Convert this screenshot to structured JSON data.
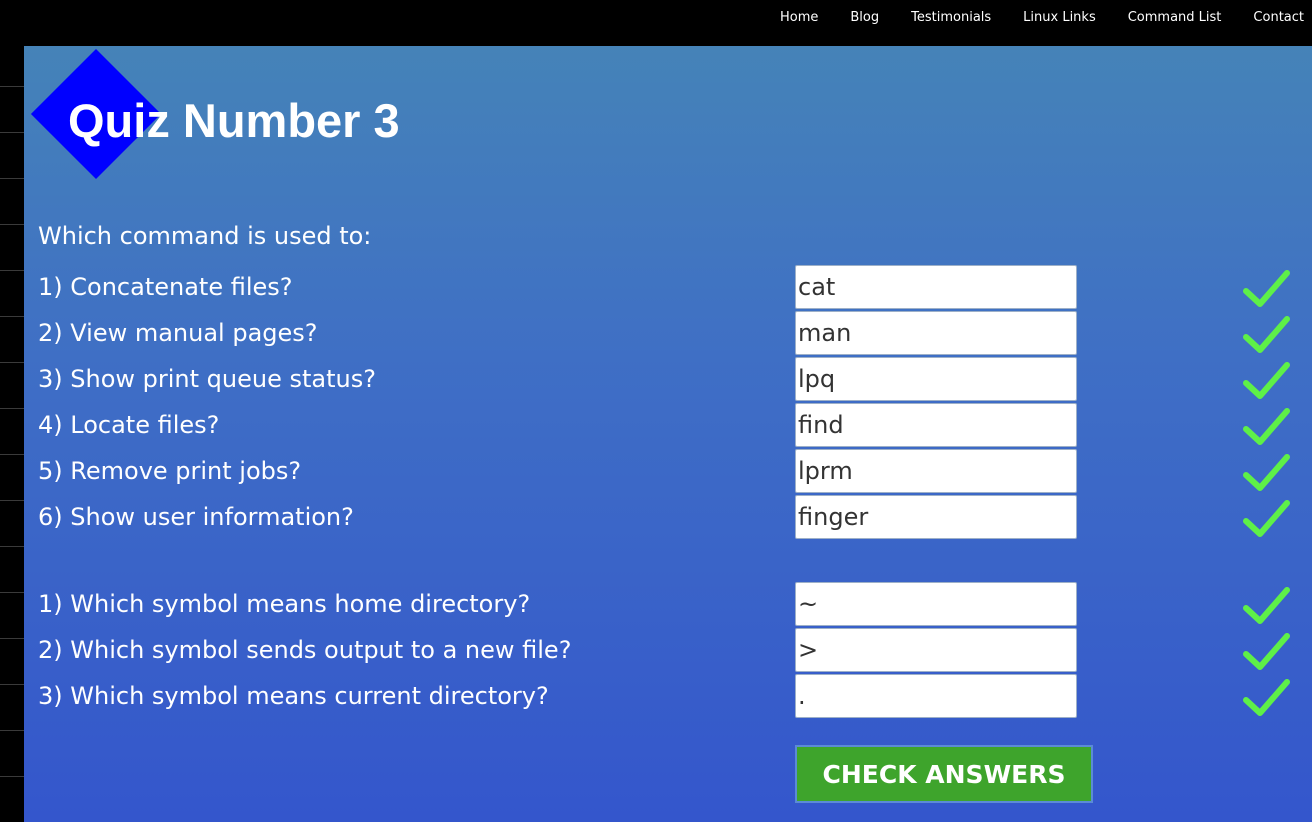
{
  "nav": {
    "items": [
      {
        "label": "Home"
      },
      {
        "label": "Blog"
      },
      {
        "label": "Testimonials"
      },
      {
        "label": "Linux Links"
      },
      {
        "label": "Command List"
      },
      {
        "label": "Contact"
      }
    ]
  },
  "quiz": {
    "title": "Quiz Number 3",
    "logo_icon": "blue-diamond",
    "intro": "Which command is used to:",
    "questions": [
      {
        "label": "1) Concatenate files?",
        "answer": "cat",
        "status": "correct"
      },
      {
        "label": "2) View manual pages?",
        "answer": "man",
        "status": "correct"
      },
      {
        "label": "3) Show print queue status?",
        "answer": "lpq",
        "status": "correct"
      },
      {
        "label": "4) Locate files?",
        "answer": "find",
        "status": "correct"
      },
      {
        "label": "5) Remove print jobs?",
        "answer": "lprm",
        "status": "correct"
      },
      {
        "label": "6) Show user information?",
        "answer": "finger",
        "status": "correct"
      },
      {
        "label": "1) Which symbol means home directory?",
        "answer": "~",
        "status": "correct"
      },
      {
        "label": "2) Which symbol sends output to a new file?",
        "answer": ">",
        "status": "correct"
      },
      {
        "label": "3) Which symbol means current directory?",
        "answer": ".",
        "status": "correct"
      }
    ],
    "check_icon": "checkmark-icon",
    "submit_label": "CHECK ANSWERS"
  },
  "colors": {
    "accent_diamond": "#0000ff",
    "check_green": "#5ef048",
    "button_green": "#3ea42c",
    "background_top": "#4583b8",
    "background_bottom": "#3456cc"
  }
}
